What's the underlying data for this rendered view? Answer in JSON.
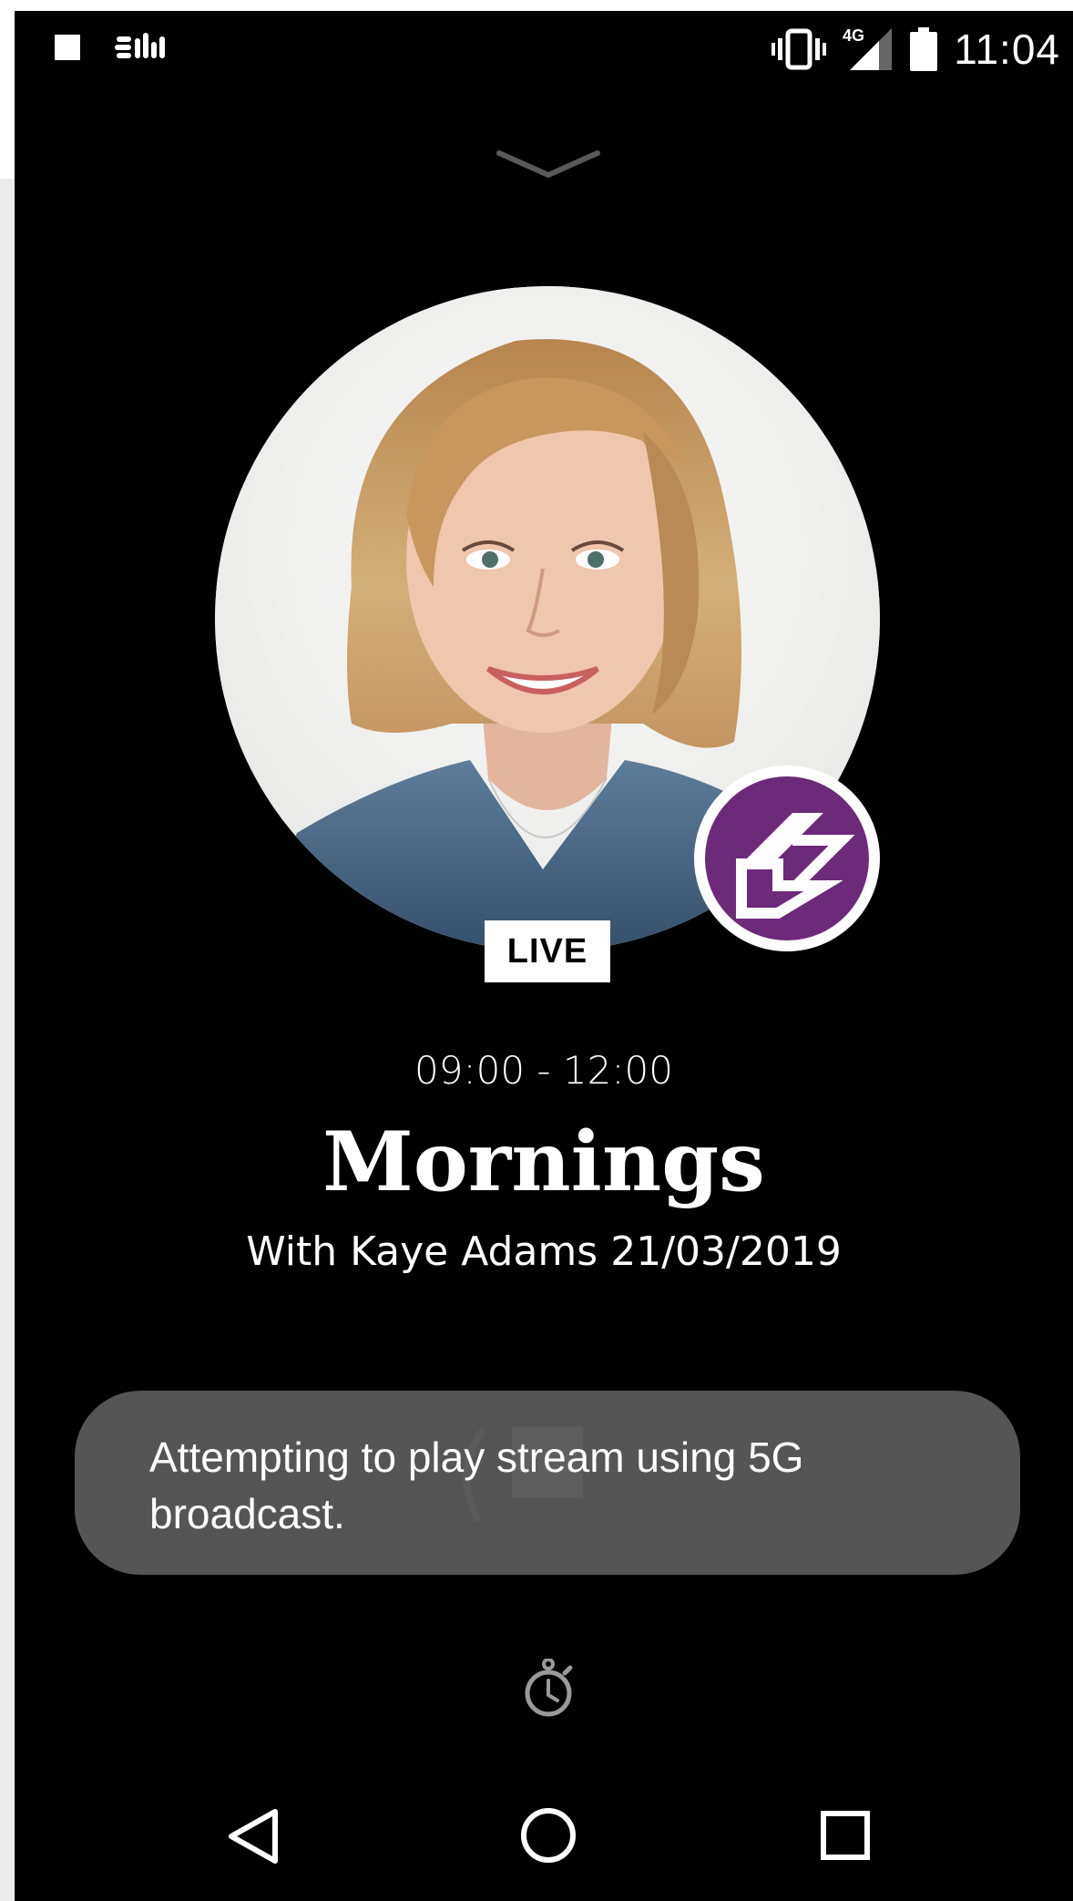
{
  "status_bar": {
    "time": "11:04",
    "network_label": "4G",
    "icons": [
      "stop-icon",
      "app-notification-icon",
      "vibrate-icon",
      "signal-icon",
      "battery-icon"
    ]
  },
  "player": {
    "live_label": "LIVE",
    "time_range": "09:00 - 12:00",
    "title": "Mornings",
    "subtitle": "With Kaye Adams 21/03/2019"
  },
  "toast": {
    "message": "Attempting to play stream using 5G broadcast."
  },
  "colors": {
    "background": "#000000",
    "station_badge": "#6d2a7a",
    "toast_bg": "#5c5c5c",
    "text": "#ffffff"
  }
}
